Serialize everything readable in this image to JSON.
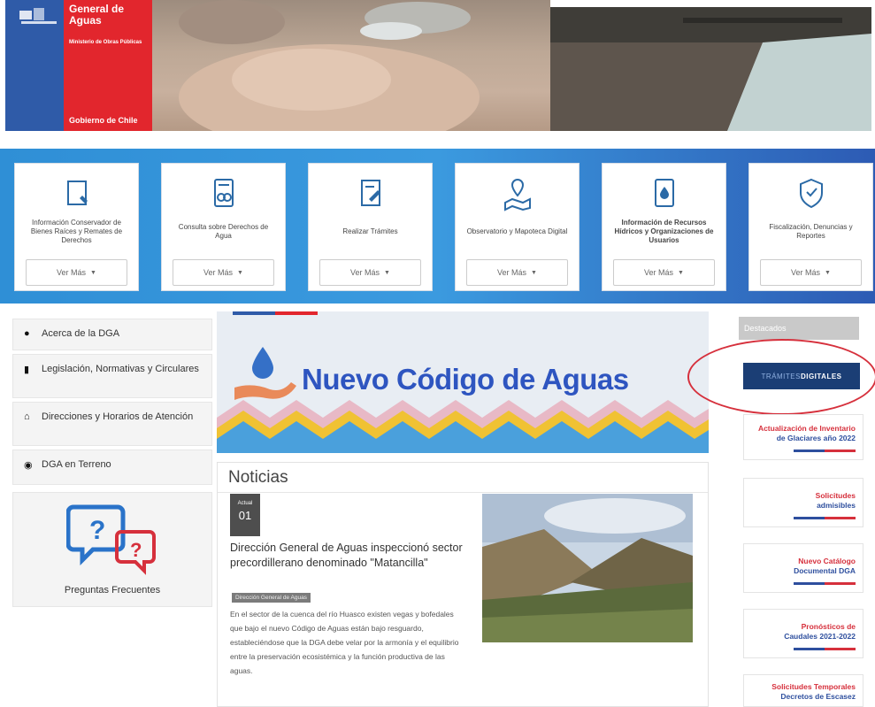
{
  "header": {
    "institution": "General de Aguas",
    "ministry": "Ministerio de Obras Públicas",
    "government": "Gobierno de Chile"
  },
  "services": [
    {
      "title": "Información Conservador de Bienes Raíces y Remates de Derechos",
      "button": "Ver Más",
      "icon": "document-pen-icon"
    },
    {
      "title": "Consulta sobre Derechos de Agua",
      "button": "Ver Más",
      "icon": "search-document-icon"
    },
    {
      "title": "Realizar Trámites",
      "button": "Ver Más",
      "icon": "form-pen-icon"
    },
    {
      "title": "Observatorio y Mapoteca Digital",
      "button": "Ver Más",
      "icon": "map-pin-icon"
    },
    {
      "title": "Información de Recursos Hídricos y Organizaciones de Usuarios",
      "button": "Ver Más",
      "icon": "water-document-icon"
    },
    {
      "title": "Fiscalización, Denuncias y Reportes",
      "button": "Ver Más",
      "icon": "shield-hand-icon"
    }
  ],
  "sidebar": {
    "items": [
      {
        "label": "Acerca de la DGA",
        "icon": "info-circle-icon"
      },
      {
        "label": "Legislación, Normativas y Circulares",
        "icon": "book-icon"
      },
      {
        "label": "Direcciones y Horarios de Atención",
        "icon": "home-icon"
      },
      {
        "label": "DGA en Terreno",
        "icon": "globe-icon"
      }
    ],
    "faq_label": "Preguntas Frecuentes"
  },
  "banner": {
    "title": "Nuevo Código de Aguas"
  },
  "news": {
    "heading": "Noticias",
    "date_month": "Actual",
    "date_day": "01",
    "title": "Dirección General de Aguas inspeccionó sector precordillerano denominado \"Matancilla\"",
    "tag": "Dirección General de Aguas",
    "body": "En el sector de la cuenca del río Huasco existen vegas y bofedales que bajo el nuevo Código de Aguas están bajo resguardo, estableciéndose que la DGA debe velar por la armonía y el equilibrio entre la preservación ecosistémica y la función productiva de las aguas."
  },
  "destacados": {
    "heading": "Destacados",
    "tramites_part1": "TRÁMITES",
    "tramites_part2": "DIGITALES",
    "links": [
      {
        "line1": "Actualización de Inventario",
        "line2": "de Glaciares año 2022"
      },
      {
        "line1": "Solicitudes",
        "line2": "admisibles"
      },
      {
        "line1": "Nuevo Catálogo",
        "line2": "Documental DGA"
      },
      {
        "line1": "Pronósticos de",
        "line2": "Caudales 2021-2022"
      },
      {
        "line1": "Solicitudes Temporales",
        "line2": "Decretos de Escasez"
      }
    ]
  },
  "colors": {
    "gov_blue": "#2f5ba8",
    "gov_red": "#e2262d",
    "band_blue": "#3b9adf",
    "banner_title": "#2e55c0",
    "link_red": "#d6303c",
    "link_blue": "#2e4f9e"
  }
}
